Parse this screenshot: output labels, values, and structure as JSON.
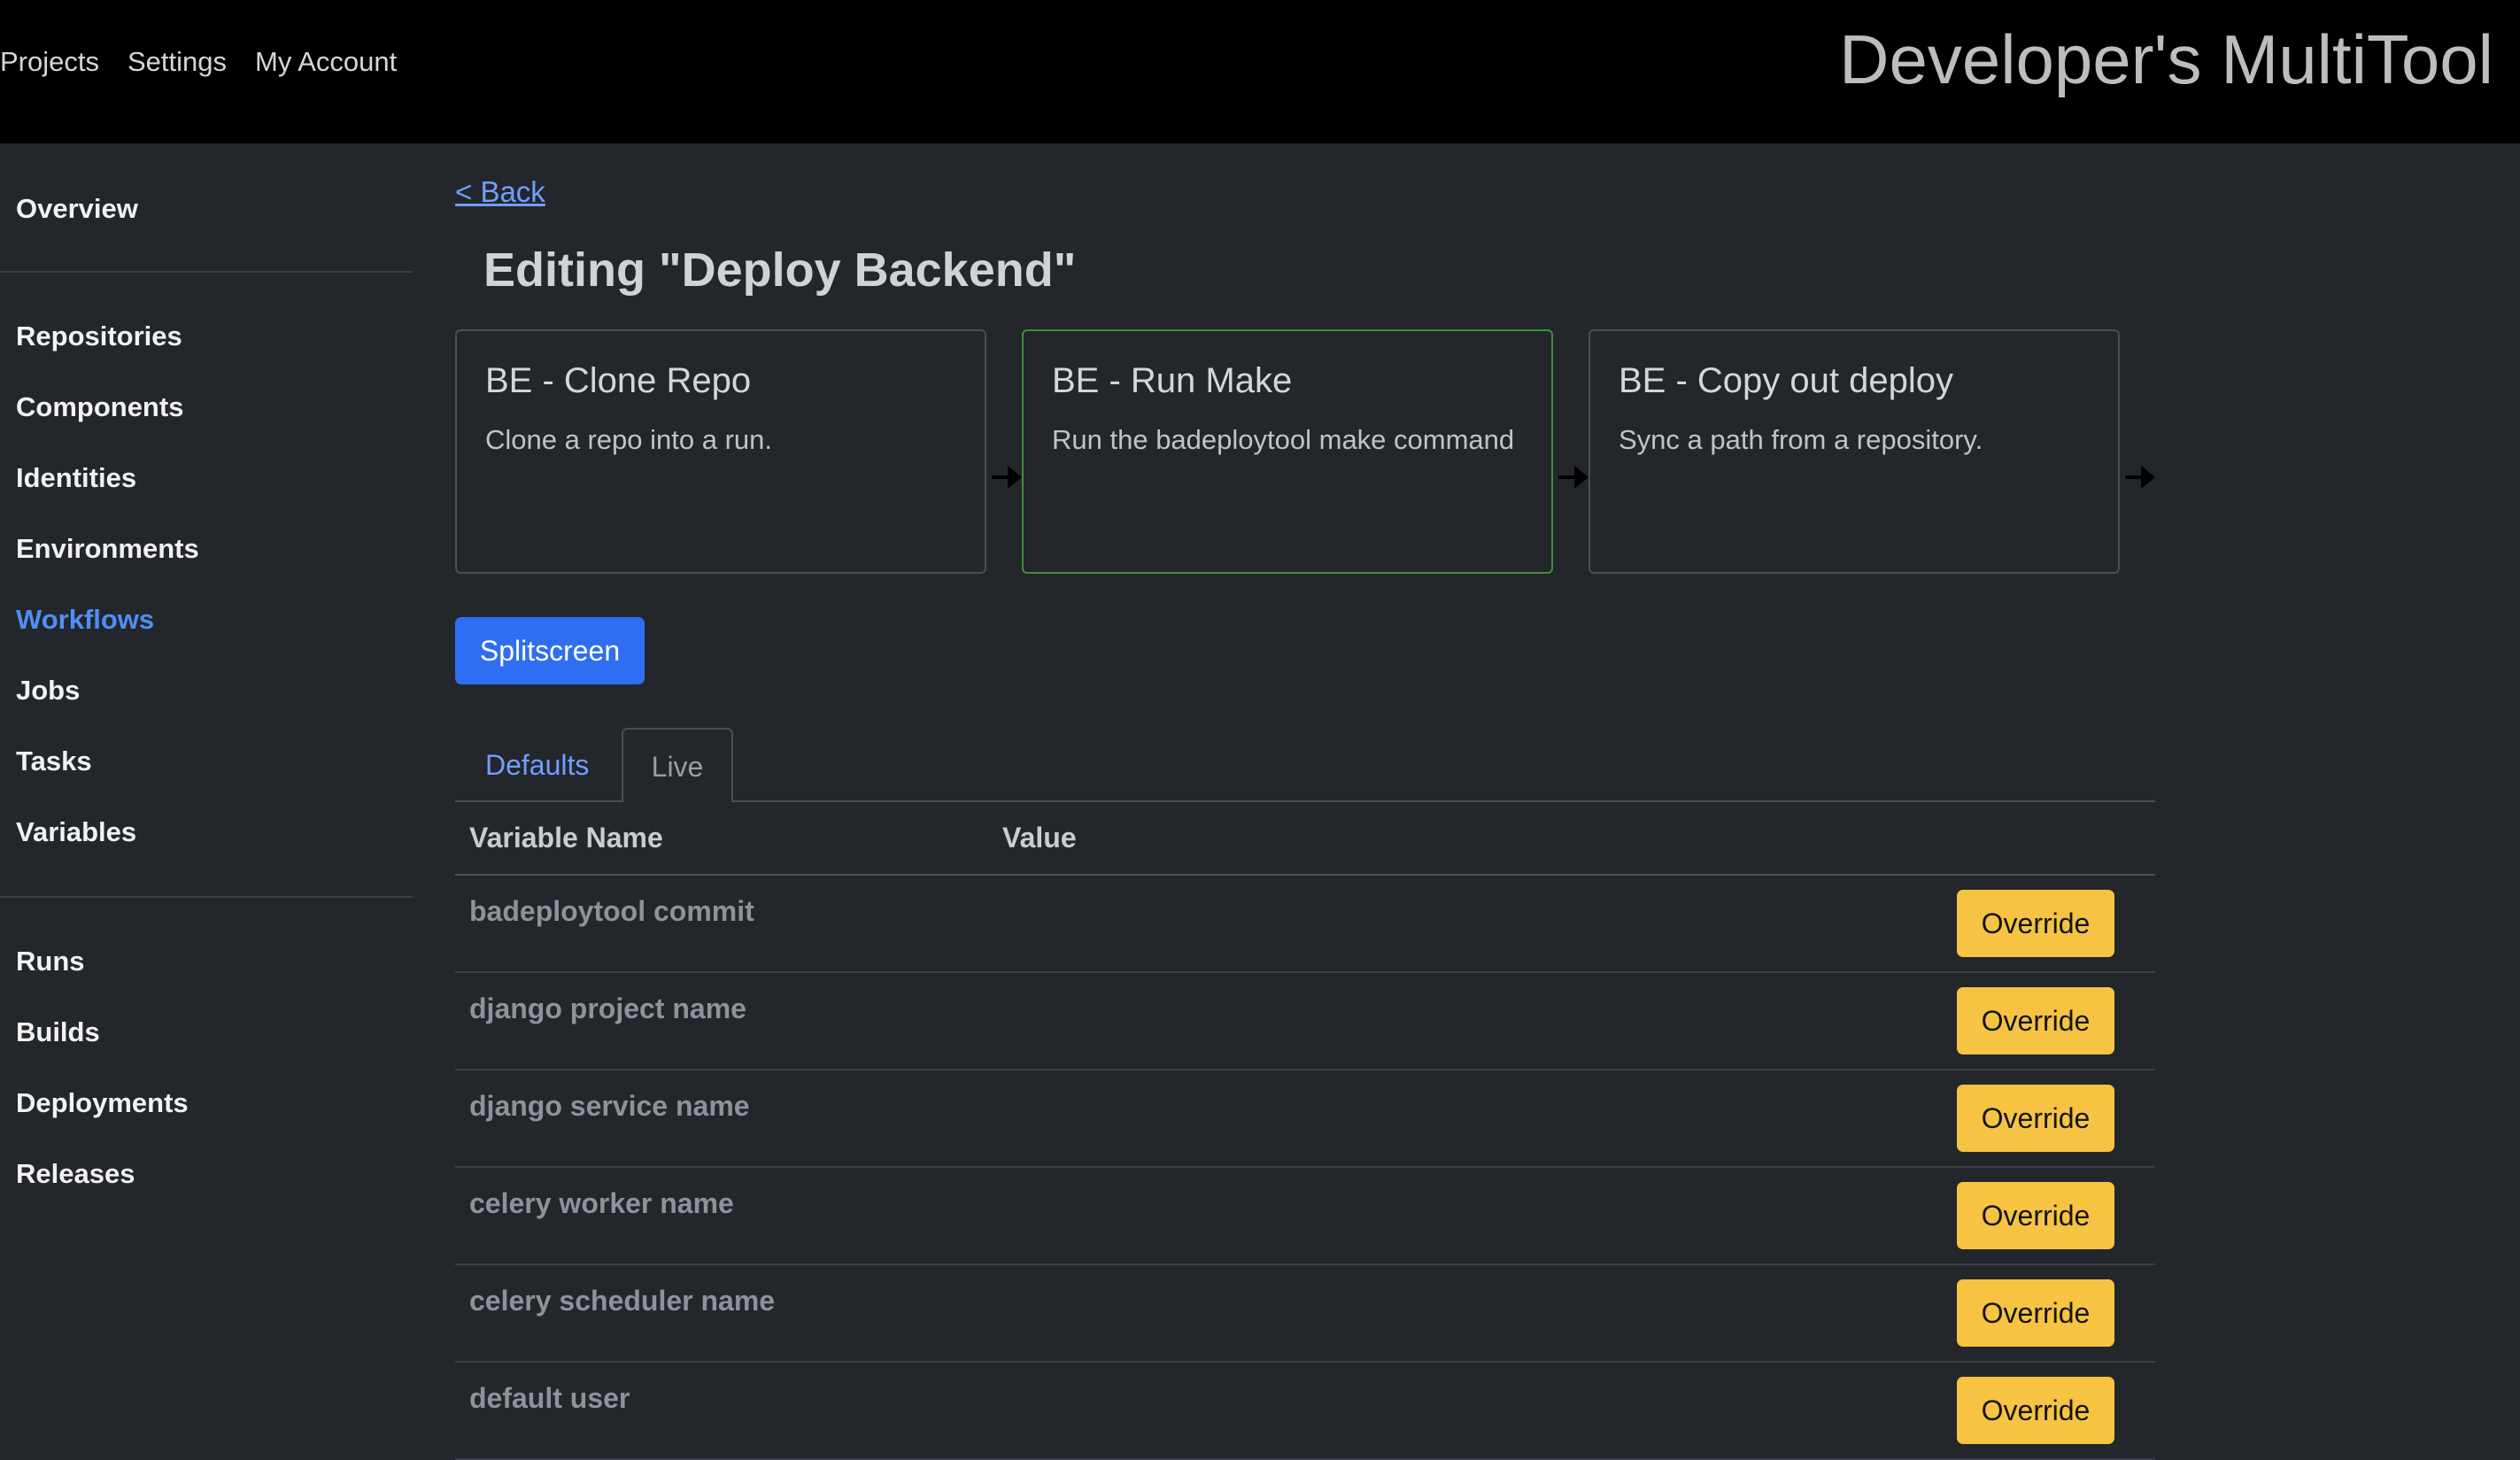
{
  "topnav": {
    "items": [
      "Projects",
      "Settings",
      "My Account"
    ]
  },
  "brand": "Developer's MultiTool",
  "sidebar": {
    "overview": "Overview",
    "group1": [
      "Repositories",
      "Components",
      "Identities",
      "Environments",
      "Workflows",
      "Jobs",
      "Tasks",
      "Variables"
    ],
    "group2": [
      "Runs",
      "Builds",
      "Deployments",
      "Releases"
    ],
    "active": "Workflows"
  },
  "main": {
    "back": "< Back",
    "title": "Editing \"Deploy Backend\"",
    "steps": [
      {
        "title": "BE - Clone Repo",
        "desc": "Clone a repo into a run."
      },
      {
        "title": "BE - Run Make",
        "desc": "Run the badeploytool make command"
      },
      {
        "title": "BE - Copy out deploy",
        "desc": "Sync a path from a repository."
      }
    ],
    "splitscreen": "Splitscreen",
    "tabs": [
      "Defaults",
      "Live"
    ],
    "table": {
      "headers": [
        "Variable Name",
        "Value"
      ],
      "rows": [
        {
          "name": "badeploytool commit",
          "value": ""
        },
        {
          "name": "django project name",
          "value": ""
        },
        {
          "name": "django service name",
          "value": ""
        },
        {
          "name": "celery worker name",
          "value": ""
        },
        {
          "name": "celery scheduler name",
          "value": ""
        },
        {
          "name": "default user",
          "value": ""
        }
      ],
      "override_label": "Override"
    }
  },
  "colors": {
    "accent": "#2f6ef2",
    "link": "#6ea0ff",
    "override": "#f6c343",
    "selected_border": "#3f8f3a",
    "background": "#23262b",
    "topbar": "#000000"
  }
}
